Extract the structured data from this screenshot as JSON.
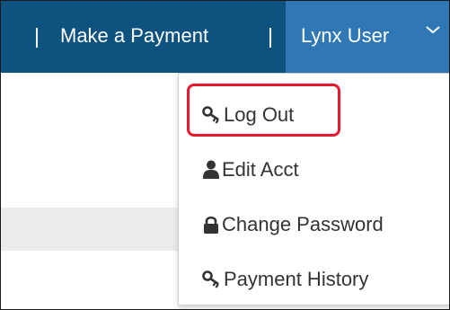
{
  "navbar": {
    "separator": "|",
    "make_payment_label": "Make a Payment",
    "user_label": "Lynx User",
    "chevron_icon": "chevron-down-icon"
  },
  "dropdown": {
    "items": [
      {
        "label": "Log Out",
        "icon": "key-icon"
      },
      {
        "label": "Edit Acct",
        "icon": "user-icon"
      },
      {
        "label": "Change Password",
        "icon": "lock-icon"
      },
      {
        "label": "Payment History",
        "icon": "key-icon"
      }
    ]
  },
  "colors": {
    "navbar": "#0e5280",
    "user_menu": "#2f78b5",
    "highlight": "#e8192c"
  }
}
